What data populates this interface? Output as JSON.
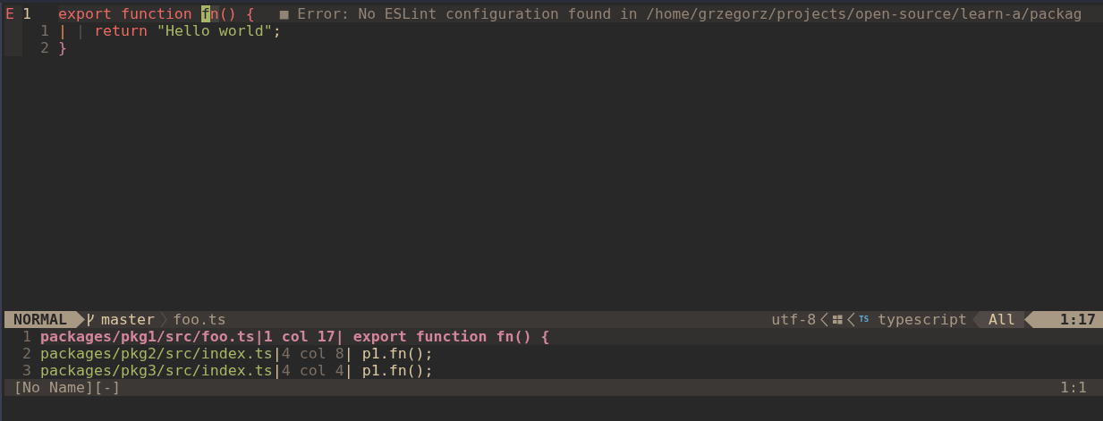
{
  "editor": {
    "lines": [
      {
        "sign": "E",
        "number": "1",
        "current": true,
        "tokens": [
          {
            "text": "export function ",
            "kind": "keyword"
          },
          {
            "text": "f",
            "kind": "cursor"
          },
          {
            "text": "n",
            "kind": "match"
          },
          {
            "text": "() {",
            "kind": "keyword"
          }
        ],
        "diagnostic": {
          "marker": "■",
          "text": "Error: No ESLint configuration found in /home/grzegorz/projects/open-source/learn-a/packag"
        }
      },
      {
        "number": "1",
        "current": false,
        "tokens": [
          {
            "text": "| ",
            "kind": "guide-active"
          },
          {
            "text": "| ",
            "kind": "guide"
          },
          {
            "text": "return ",
            "kind": "keyword"
          },
          {
            "text": "\"Hello world\"",
            "kind": "string"
          },
          {
            "text": ";",
            "kind": "plain"
          }
        ]
      },
      {
        "number": "2",
        "current": false,
        "tokens": [
          {
            "text": "}",
            "kind": "brace"
          }
        ]
      }
    ]
  },
  "statusline": {
    "mode": "NORMAL",
    "branch": "master",
    "file": "foo.ts",
    "encoding": "utf-8",
    "filetype_icon": "TS",
    "filetype": "typescript",
    "scroll": "All",
    "position": "1:17"
  },
  "quickfix": {
    "items": [
      {
        "number": "1",
        "file": "packages/pkg1/src/foo.ts",
        "separator": "|",
        "location": "1 col 17",
        "text": "| export function fn() {",
        "selected": true
      },
      {
        "number": "2",
        "file": "packages/pkg2/src/index.ts",
        "separator": "|",
        "location": "4 col 8",
        "text": "| p1.fn();",
        "selected": false
      },
      {
        "number": "3",
        "file": "packages/pkg3/src/index.ts",
        "separator": "|",
        "location": "4 col 4",
        "text": "| p1.fn();",
        "selected": false
      }
    ],
    "status": {
      "name": "[No Name][-]",
      "position": "1:1"
    }
  }
}
